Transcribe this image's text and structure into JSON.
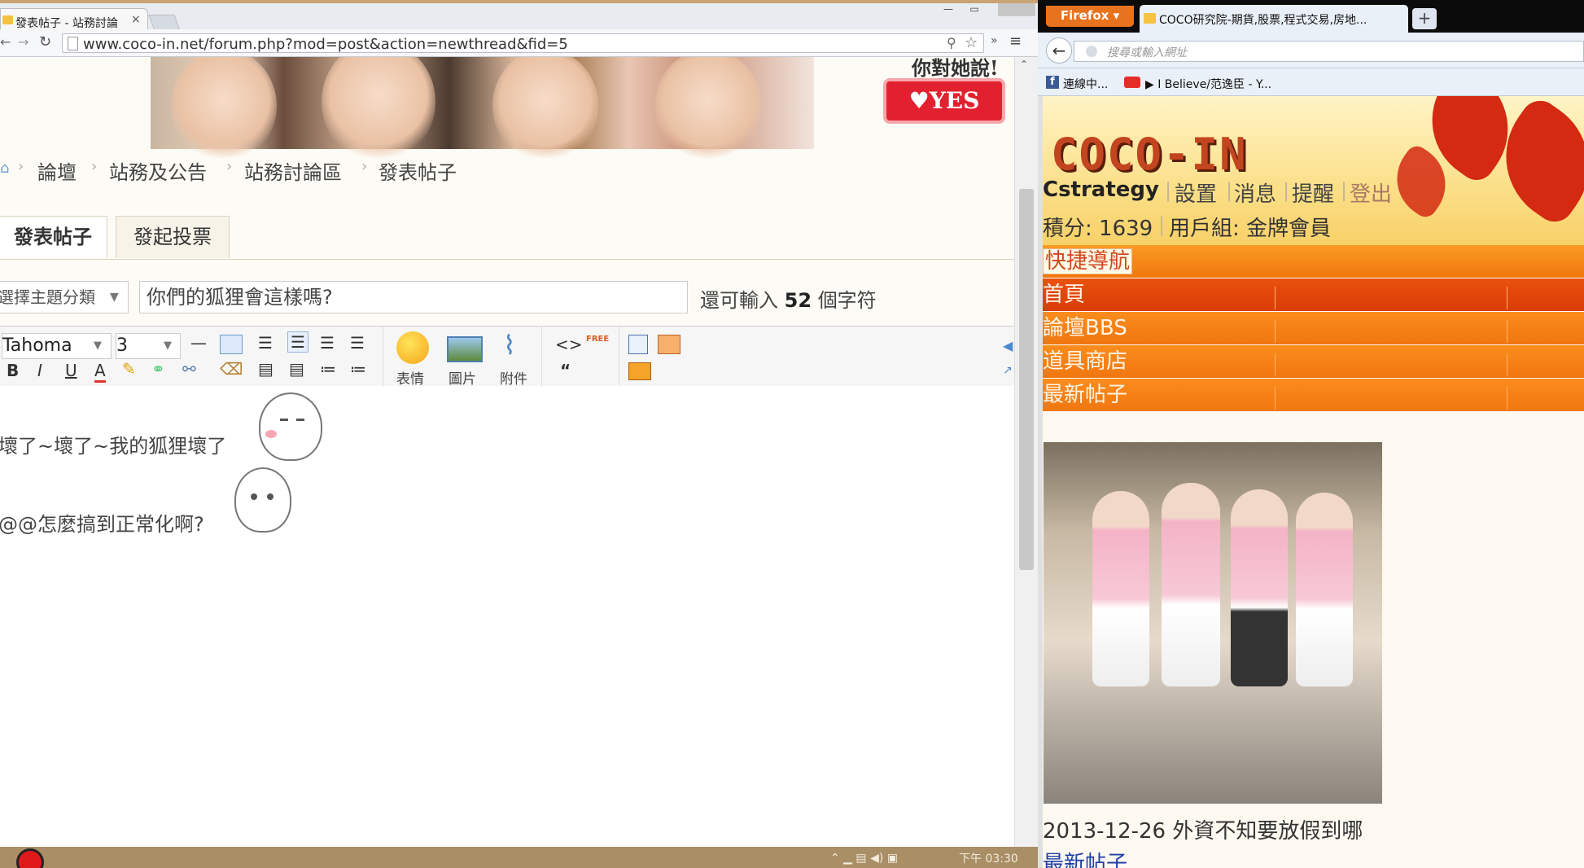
{
  "chrome": {
    "tab_title": "發表帖子 - 站務討論",
    "tab_close": "×",
    "url": "www.coco-in.net/forum.php?mod=post&action=newthread&fid=5",
    "banner_text": "你對她說!",
    "banner_yes": "♥YES",
    "breadcrumbs": [
      "論壇",
      "站務及公告",
      "站務討論區",
      "發表帖子"
    ],
    "tabs": [
      "發表帖子",
      "發起投票"
    ],
    "category_select": "選擇主題分類",
    "subject_value": "你們的狐狸會這樣嗎?",
    "remaining_prefix": "還可輸入",
    "remaining_count": "52",
    "remaining_suffix": "個字符",
    "editor": {
      "font": "Tahoma",
      "size": "3",
      "emoticon_label": "表情",
      "image_label": "圖片",
      "attach_label": "附件",
      "free_label": "FREE"
    },
    "post_lines": [
      "壞了~壞了~我的狐狸壞了",
      "@@怎麼搞到正常化啊?"
    ],
    "clock": "下午 03:30"
  },
  "firefox": {
    "menu_label": "Firefox",
    "tab_title": "COCO研究院-期貨,股票,程式交易,房地...",
    "new_tab": "+",
    "url_placeholder": "搜尋或輸入網址",
    "bookmarks": [
      "連線中...",
      "I Believe/范逸臣 - Y..."
    ],
    "logo_text": "COCO-IN",
    "user": {
      "name": "Cstrategy",
      "links": [
        "設置",
        "消息",
        "提醒",
        "登出"
      ],
      "points_label": "積分: 1639",
      "group_label": "用戶組: 金牌會員"
    },
    "nav": [
      "快捷導航",
      "首頁",
      "論壇BBS",
      "道具商店",
      "最新帖子"
    ],
    "news_item": "2013-12-26 外資不知要放假到哪",
    "more_link": "最新帖子"
  },
  "colors": {
    "nav_orange": "#f07c10",
    "nav_red": "#e24a0c",
    "status_bar": "#a98e66",
    "firefox_menu": "#e7731f"
  }
}
